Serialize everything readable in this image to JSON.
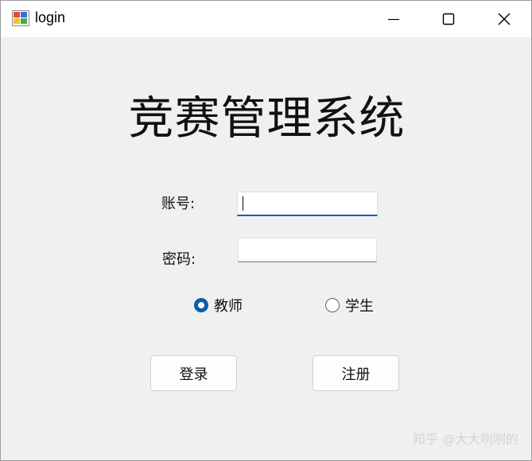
{
  "window": {
    "title": "login",
    "icons": {
      "app": "form-app-icon",
      "minimize": "minimize-icon",
      "maximize": "maximize-icon",
      "close": "close-icon"
    }
  },
  "form": {
    "heading": "竞赛管理系统",
    "account_label": "账号:",
    "account_value": "",
    "password_label": "密码:",
    "password_value": "",
    "role_options": [
      {
        "label": "教师",
        "checked": true
      },
      {
        "label": "学生",
        "checked": false
      }
    ],
    "login_button": "登录",
    "register_button": "注册"
  },
  "watermark": "知乎 @大大咧咧的",
  "colors": {
    "accent": "#0b5cad",
    "focus_underline": "#1a5fb4",
    "window_background": "#f0f0f0",
    "titlebar_background": "#ffffff"
  }
}
